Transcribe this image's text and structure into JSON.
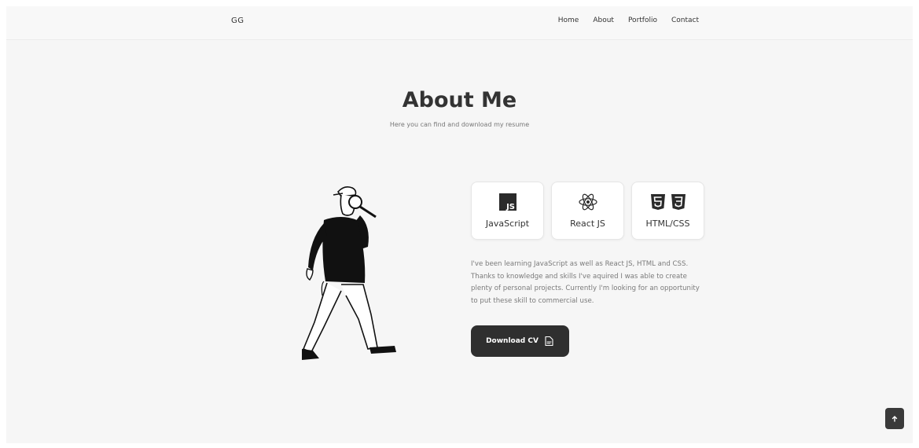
{
  "nav": {
    "logo": "GG",
    "links": [
      "Home",
      "About",
      "Portfolio",
      "Contact"
    ]
  },
  "hero": {
    "title": "About Me",
    "subtitle": "Here you can find and download my resume"
  },
  "skills": [
    {
      "label": "JavaScript",
      "icon": "javascript-icon"
    },
    {
      "label": "React JS",
      "icon": "react-icon"
    },
    {
      "label": "HTML/CSS",
      "icon": "html-css-icon"
    }
  ],
  "about": {
    "text": "I've been learning JavaScript as well as React JS, HTML and CSS. Thanks to knowledge and skills I've aquired I was able to create plenty of personal projects. Currently I'm looking for an opportunity to put these skill to commercial use."
  },
  "cv_button": {
    "label": "Download CV",
    "icon": "document-icon"
  },
  "scroll_top": {
    "icon": "arrow-up-icon"
  },
  "colors": {
    "background": "#f6f6f6",
    "button": "#2f2f2f",
    "text": "#333333",
    "muted": "#7a7a7a"
  }
}
